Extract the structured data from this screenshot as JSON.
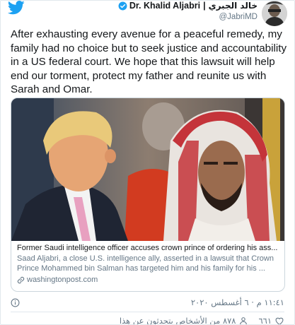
{
  "author": {
    "name_en": "Dr. Khalid Aljabri",
    "separator": "|",
    "name_ar": "خالد الجبري",
    "handle": "@JabriMD"
  },
  "tweet": {
    "text": "After exhausting every avenue for a peaceful remedy, my family had no choice but to seek justice and accountability in a US federal court. We hope that this lawsuit will help end our torment, protect my father and reunite us with Sarah and Omar."
  },
  "card": {
    "title": "Former Saudi intelligence officer accuses crown prince of ordering his ass...",
    "description": "Saad Aljabri, a close U.S. intelligence ally, asserted in a lawsuit that Crown Prince Mohammed bin Salman has targeted him and his family for his ...",
    "domain": "washingtonpost.com"
  },
  "footer": {
    "timestamp": "١١:٤١ م · ٦ أغسطس ٢٠٢٠",
    "likes": "٦٦١",
    "stats_text": "٨٧٨ من الأشخاص يتحدثون عن هذا"
  },
  "colors": {
    "twitter_blue": "#1da1f2",
    "secondary_text": "#657786",
    "border": "#ccd6dd"
  },
  "icons": [
    "twitter-bird-icon",
    "verified-badge-icon",
    "link-icon",
    "info-icon",
    "heart-icon",
    "person-icon"
  ]
}
